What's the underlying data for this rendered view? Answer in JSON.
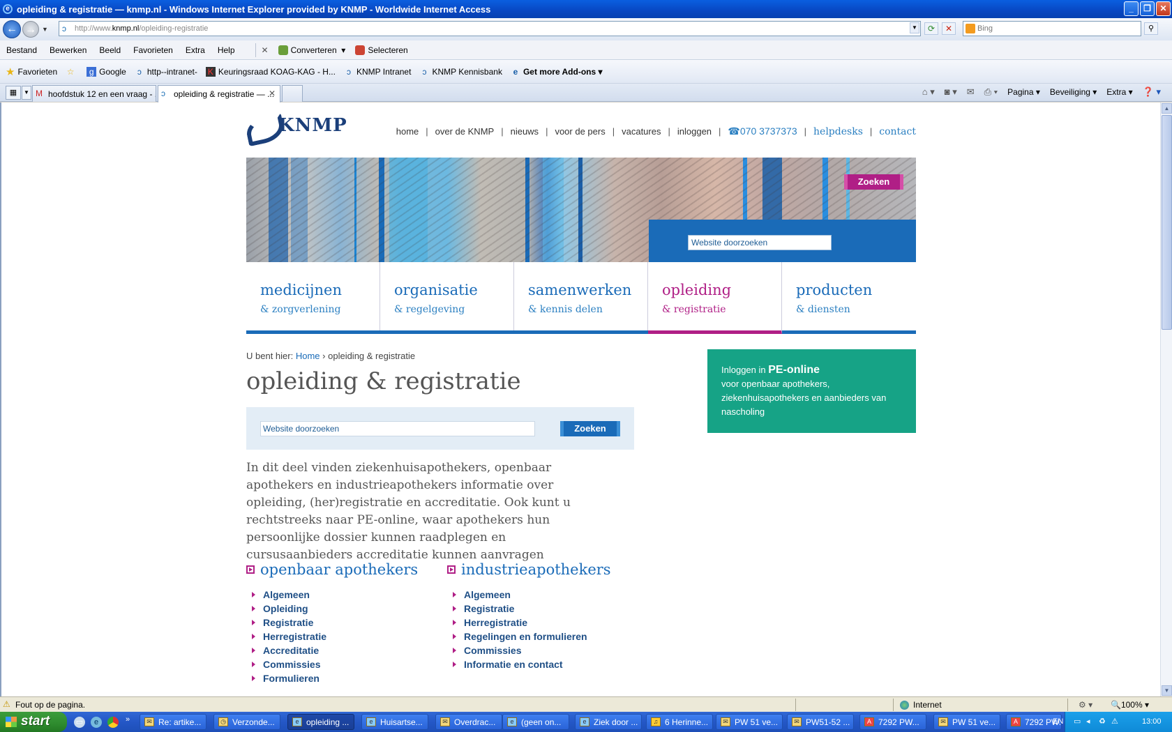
{
  "window": {
    "title": "opleiding & registratie — knmp.nl - Windows Internet Explorer provided by KNMP - Worldwide Internet Access"
  },
  "address": {
    "url_prefix": "http://www.",
    "url_domain": "knmp.nl",
    "url_path": "/opleiding-registratie",
    "search_placeholder": "Bing"
  },
  "menu": {
    "items": [
      "Bestand",
      "Bewerken",
      "Beeld",
      "Favorieten",
      "Extra",
      "Help"
    ],
    "converteren": "Converteren",
    "selecteren": "Selecteren"
  },
  "favorites": {
    "label": "Favorieten",
    "items": [
      "Google",
      "http--intranet-",
      "Keuringsraad KOAG-KAG - H...",
      "KNMP Intranet",
      "KNMP Kennisbank",
      "Get more Add-ons"
    ]
  },
  "tabs": [
    {
      "label": "hoofdstuk 12 en een vraag - ..."
    },
    {
      "label": "opleiding & registratie — ..."
    }
  ],
  "commandbar": {
    "pagina": "Pagina",
    "beveiliging": "Beveiliging",
    "extra": "Extra"
  },
  "page": {
    "topnav": [
      "home",
      "over de KNMP",
      "nieuws",
      "voor de pers",
      "vacatures",
      "inloggen"
    ],
    "phone": "070 3737373",
    "helpdesks": "helpdesks",
    "contact": "contact",
    "logo_text": "KNMP",
    "banner_search_placeholder": "Website doorzoeken",
    "banner_search_button": "Zoeken",
    "mainnav": [
      {
        "title": "medicijnen",
        "sub": "& zorgverlening"
      },
      {
        "title": "organisatie",
        "sub": "& regelgeving"
      },
      {
        "title": "samenwerken",
        "sub": "& kennis delen"
      },
      {
        "title": "opleiding",
        "sub": "& registratie"
      },
      {
        "title": "producten",
        "sub": "& diensten"
      }
    ],
    "breadcrumb": {
      "prefix": "U bent hier:",
      "home": "Home",
      "sep": "›",
      "current": "opleiding & registratie"
    },
    "title": "opleiding & registratie",
    "inline_search_placeholder": "Website doorzoeken",
    "inline_search_button": "Zoeken",
    "intro": "In dit deel vinden ziekenhuisapothekers, openbaar apothekers en industrieapothekers informatie over opleiding, (her)registratie en accreditatie. Ook kunt u rechtstreeks naar PE-online, waar apothekers hun persoonlijke dossier kunnen raadplegen en cursusaanbieders accreditatie kunnen aanvragen",
    "col1": {
      "title": "openbaar apothekers",
      "items": [
        "Algemeen",
        "Opleiding",
        "Registratie",
        "Herregistratie",
        "Accreditatie",
        "Commissies",
        "Formulieren"
      ]
    },
    "col2": {
      "title": "industrieapothekers",
      "items": [
        "Algemeen",
        "Registratie",
        "Herregistratie",
        "Regelingen en formulieren",
        "Commissies",
        "Informatie en contact"
      ]
    },
    "pe": {
      "prefix": "Inloggen in",
      "name": "PE-online",
      "text": "voor openbaar apothekers, ziekenhuisapothekers en aanbieders van nascholing"
    }
  },
  "status": {
    "text": "Fout op de pagina.",
    "zone": "Internet",
    "zoom": "100%"
  },
  "taskbar": {
    "start": "start",
    "items": [
      "Re: artike...",
      "Verzonde...",
      "opleiding ...",
      "Huisartse...",
      "Overdrac...",
      "(geen on...",
      "Ziek door ...",
      "6 Herinne...",
      "PW 51 ve...",
      "PW51-52 ...",
      "7292 PW...",
      "PW 51 ve...",
      "7292 PW..."
    ],
    "lang": "EN",
    "clock": "13:00"
  }
}
